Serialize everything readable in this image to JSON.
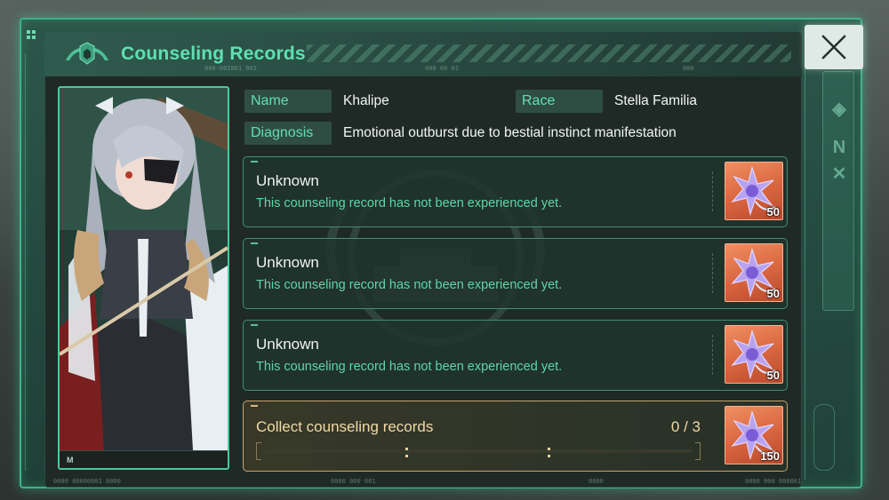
{
  "window": {
    "title": "Counseling Records",
    "codes": [
      "000-001001 001",
      "000 00 01",
      "000"
    ],
    "footer_codes": [
      "0000 00000001 0000",
      "0000 000 001",
      "0000",
      "0000 000 000001"
    ]
  },
  "close_button": {
    "icon": "close-icon"
  },
  "portrait": {
    "footer_label": "M"
  },
  "profile": {
    "name_label": "Name",
    "name_value": "Khalipe",
    "race_label": "Race",
    "race_value": "Stella Familia",
    "diagnosis_label": "Diagnosis",
    "diagnosis_value": "Emotional outburst due to bestial instinct manifestation"
  },
  "records": [
    {
      "title": "Unknown",
      "description": "This counseling record has not been experienced yet.",
      "reward_count": "50",
      "reward_icon": "star-crystal-icon"
    },
    {
      "title": "Unknown",
      "description": "This counseling record has not been experienced yet.",
      "reward_count": "50",
      "reward_icon": "star-crystal-icon"
    },
    {
      "title": "Unknown",
      "description": "This counseling record has not been experienced yet.",
      "reward_count": "50",
      "reward_icon": "star-crystal-icon"
    }
  ],
  "collect": {
    "label": "Collect counseling records",
    "count_text": "0 / 3",
    "progress": 0,
    "reward_count": "150",
    "reward_icon": "star-crystal-icon"
  },
  "colors": {
    "accent": "#5fe0b2",
    "frame": "#3fb28a",
    "gold": "#c8a46a",
    "reward_bg": "#d8643f"
  }
}
